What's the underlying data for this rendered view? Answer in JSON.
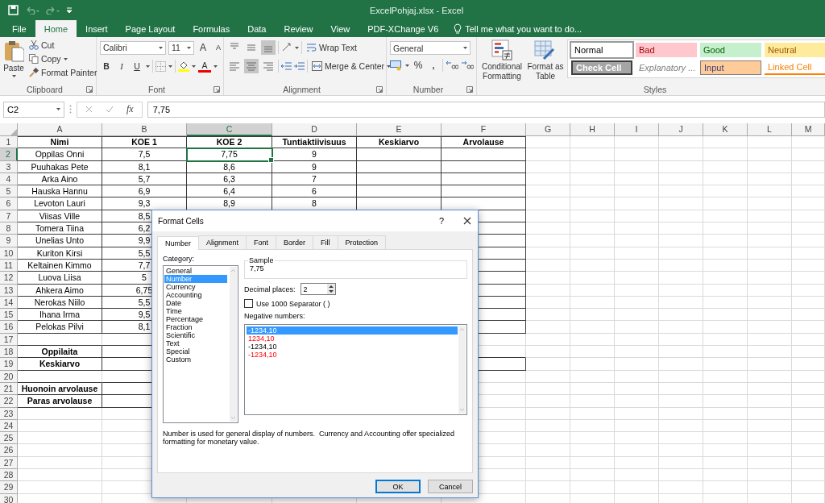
{
  "window": {
    "title": "ExcelPohjaj.xlsx - Excel"
  },
  "quick_access": [
    {
      "kind": "save"
    },
    {
      "kind": "undo"
    },
    {
      "kind": "redo"
    },
    {
      "kind": "customize"
    }
  ],
  "ribbon_tabs": [
    {
      "label": "File",
      "selected": false
    },
    {
      "label": "Home",
      "selected": true
    },
    {
      "label": "Insert",
      "selected": false
    },
    {
      "label": "Page Layout",
      "selected": false
    },
    {
      "label": "Formulas",
      "selected": false
    },
    {
      "label": "Data",
      "selected": false
    },
    {
      "label": "Review",
      "selected": false
    },
    {
      "label": "View",
      "selected": false
    },
    {
      "label": "PDF-XChange V6",
      "selected": false
    }
  ],
  "tell_me": {
    "placeholder": "Tell me what you want to do..."
  },
  "clipboard": {
    "label": "Clipboard",
    "paste": "Paste",
    "cut": "Cut",
    "copy": "Copy",
    "format_painter": "Format Painter"
  },
  "font": {
    "label": "Font",
    "name": "Calibri",
    "size": "11",
    "grow": "A",
    "shrink": "A",
    "bold": "B",
    "italic": "I",
    "underline": "U",
    "tint_glyph": "A"
  },
  "alignment": {
    "label": "Alignment",
    "wrap_text": "Wrap Text",
    "merge_center": "Merge & Center",
    "vertical": [
      {
        "kind": "top",
        "selected": false
      },
      {
        "kind": "middle",
        "selected": false
      },
      {
        "kind": "bottom",
        "selected": true
      }
    ],
    "horizontal": [
      {
        "kind": "left",
        "selected": false
      },
      {
        "kind": "center",
        "selected": true
      },
      {
        "kind": "right",
        "selected": false
      }
    ]
  },
  "number": {
    "label": "Number",
    "format": "General",
    "percent": "%",
    "comma": ","
  },
  "styles": {
    "label": "Styles",
    "conditional_formatting": "Conditional\nFormatting",
    "format_as_table": "Format as\nTable",
    "gallery": [
      {
        "name": "Normal",
        "kind": "normal",
        "selected": true
      },
      {
        "name": "Bad",
        "kind": "bad",
        "selected": false
      },
      {
        "name": "Good",
        "kind": "good",
        "selected": false
      },
      {
        "name": "Neutral",
        "kind": "neutral",
        "selected": false
      },
      {
        "name": "Check Cell",
        "kind": "check",
        "selected": false
      },
      {
        "name": "Explanatory ...",
        "kind": "explanatory",
        "selected": false
      },
      {
        "name": "Input",
        "kind": "input",
        "selected": false
      },
      {
        "name": "Linked Cell",
        "kind": "linked",
        "selected": false
      }
    ]
  },
  "formula_bar": {
    "name_box": "C2",
    "function_button": "fx",
    "value": "7,75"
  },
  "sheet": {
    "columns": [
      {
        "label": "A",
        "selected": false
      },
      {
        "label": "B",
        "selected": false
      },
      {
        "label": "C",
        "selected": true
      },
      {
        "label": "D",
        "selected": false
      },
      {
        "label": "E",
        "selected": false
      },
      {
        "label": "F",
        "selected": false
      },
      {
        "label": "G",
        "selected": false
      },
      {
        "label": "H",
        "selected": false
      },
      {
        "label": "I",
        "selected": false
      },
      {
        "label": "J",
        "selected": false
      },
      {
        "label": "K",
        "selected": false
      },
      {
        "label": "L",
        "selected": false
      },
      {
        "label": "M",
        "selected": false
      }
    ],
    "rows": [
      {
        "number": "1",
        "selected": false,
        "bold": true,
        "cells": [
          "Nimi",
          "KOE 1",
          "KOE 2",
          "Tuntiaktiivisuus",
          "Keskiarvo",
          "Arvolause"
        ]
      },
      {
        "number": "2",
        "selected": true,
        "bold": false,
        "cells": [
          "Oppilas Onni",
          "7,5",
          "7,75",
          "9"
        ]
      },
      {
        "number": "3",
        "selected": false,
        "bold": false,
        "cells": [
          "Puuhakas Pete",
          "8,1",
          "8,6",
          "9"
        ]
      },
      {
        "number": "4",
        "selected": false,
        "bold": false,
        "cells": [
          "Arka Aino",
          "5,7",
          "6,3",
          "7"
        ]
      },
      {
        "number": "5",
        "selected": false,
        "bold": false,
        "cells": [
          "Hauska Hannu",
          "6,9",
          "6,4",
          "6"
        ]
      },
      {
        "number": "6",
        "selected": false,
        "bold": false,
        "cells": [
          "Levoton Lauri",
          "9,3",
          "8,9",
          "8"
        ]
      },
      {
        "number": "7",
        "selected": false,
        "bold": false,
        "cells": [
          "Viisas Ville",
          "8,5"
        ]
      },
      {
        "number": "8",
        "selected": false,
        "bold": false,
        "cells": [
          "Tomera Tiina",
          "6,2"
        ]
      },
      {
        "number": "9",
        "selected": false,
        "bold": false,
        "cells": [
          "Unelias Unto",
          "9,9"
        ]
      },
      {
        "number": "10",
        "selected": false,
        "bold": false,
        "cells": [
          "Kuriton Kirsi",
          "5,5"
        ]
      },
      {
        "number": "11",
        "selected": false,
        "bold": false,
        "cells": [
          "Keltainen Kimmo",
          "7,7"
        ]
      },
      {
        "number": "12",
        "selected": false,
        "bold": false,
        "cells": [
          "Luova Liisa",
          "5"
        ]
      },
      {
        "number": "13",
        "selected": false,
        "bold": false,
        "cells": [
          "Ahkera Aimo",
          "6,75"
        ]
      },
      {
        "number": "14",
        "selected": false,
        "bold": false,
        "cells": [
          "Nerokas Niilo",
          "5,5"
        ]
      },
      {
        "number": "15",
        "selected": false,
        "bold": false,
        "cells": [
          "Ihana Irma",
          "9,5"
        ]
      },
      {
        "number": "16",
        "selected": false,
        "bold": false,
        "cells": [
          "Pelokas Pilvi",
          "8,1"
        ]
      },
      {
        "number": "17",
        "selected": false
      },
      {
        "number": "18",
        "selected": false,
        "bold": true,
        "cells": [
          "Oppilaita"
        ]
      },
      {
        "number": "19",
        "selected": false,
        "bold": true,
        "cells": [
          "Keskiarvo"
        ]
      },
      {
        "number": "20",
        "selected": false
      },
      {
        "number": "21",
        "selected": false,
        "bold": true,
        "cells": [
          "Huonoin arvolause"
        ]
      },
      {
        "number": "22",
        "selected": false,
        "bold": true,
        "cells": [
          "Paras arvolause"
        ]
      },
      {
        "number": "23",
        "selected": false
      },
      {
        "number": "24",
        "selected": false
      },
      {
        "number": "25",
        "selected": false
      },
      {
        "number": "26",
        "selected": false
      },
      {
        "number": "27",
        "selected": false
      },
      {
        "number": "28",
        "selected": false
      },
      {
        "number": "29",
        "selected": false
      },
      {
        "number": "30",
        "selected": false
      }
    ]
  },
  "dialog": {
    "title": "Format Cells",
    "help": "?",
    "tabs": [
      {
        "label": "Number",
        "selected": true
      },
      {
        "label": "Alignment",
        "selected": false
      },
      {
        "label": "Font",
        "selected": false
      },
      {
        "label": "Border",
        "selected": false
      },
      {
        "label": "Fill",
        "selected": false
      },
      {
        "label": "Protection",
        "selected": false
      }
    ],
    "category_label": "Category:",
    "categories": [
      {
        "label": "General",
        "selected": false
      },
      {
        "label": "Number",
        "selected": true
      },
      {
        "label": "Currency",
        "selected": false
      },
      {
        "label": "Accounting",
        "selected": false
      },
      {
        "label": "Date",
        "selected": false
      },
      {
        "label": "Time",
        "selected": false
      },
      {
        "label": "Percentage",
        "selected": false
      },
      {
        "label": "Fraction",
        "selected": false
      },
      {
        "label": "Scientific",
        "selected": false
      },
      {
        "label": "Text",
        "selected": false
      },
      {
        "label": "Special",
        "selected": false
      },
      {
        "label": "Custom",
        "selected": false
      }
    ],
    "sample_label": "Sample",
    "sample_value": "7,75",
    "decimal_label": "Decimal places:",
    "decimal_value": "2",
    "separator": {
      "label": "Use 1000 Separator ( )",
      "checked": false
    },
    "negative_label": "Negative numbers:",
    "negative_formats": [
      {
        "label": "-1234,10",
        "selected": true
      },
      {
        "label": "1234,10",
        "kind": "red",
        "selected": false
      },
      {
        "label": "-1234,10",
        "kind": "plain",
        "selected": false
      },
      {
        "label": "-1234,10",
        "kind": "red",
        "selected": false
      }
    ],
    "description": "Number is used for general display of numbers.  Currency and Accounting offer specialized formatting for monetary value.",
    "buttons": [
      {
        "label": "OK",
        "default": true
      },
      {
        "label": "Cancel",
        "default": false
      }
    ]
  }
}
